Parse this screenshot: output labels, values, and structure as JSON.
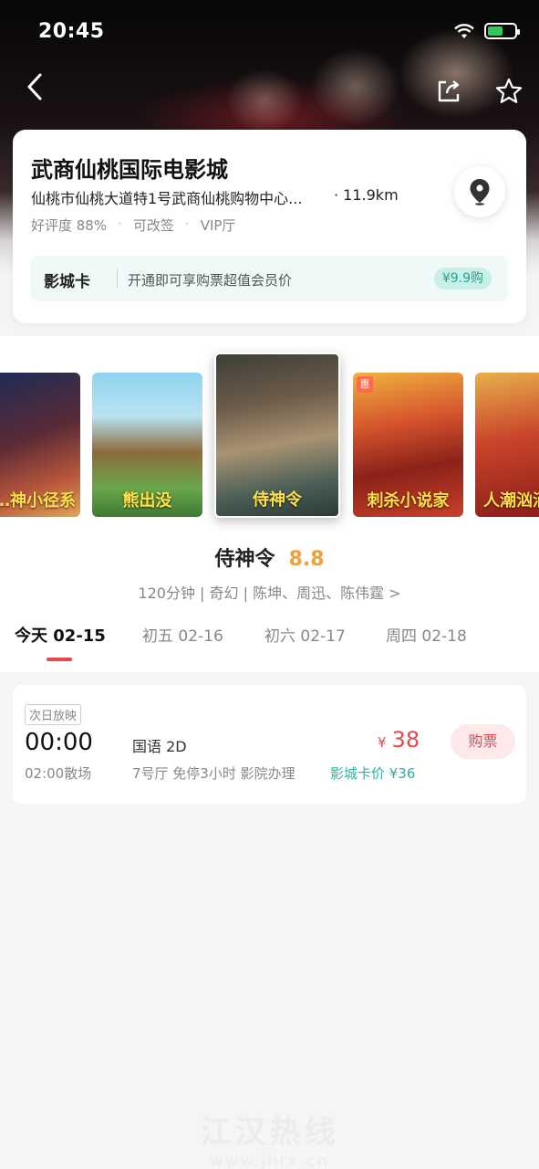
{
  "status_bar": {
    "time": "20:45"
  },
  "cinema": {
    "name": "武商仙桃国际电影城",
    "address": "仙桃市仙桃大道特1号武商仙桃购物中心...",
    "distance": "· 11.9km",
    "tags": [
      "好评度 88%",
      "可改签",
      "VIP厅"
    ],
    "card": {
      "title": "影城卡",
      "desc": "开通即可享购票超值会员价",
      "price": "¥9.9购"
    }
  },
  "posters": [
    {
      "caption": "…神小径系"
    },
    {
      "caption": "熊出没"
    },
    {
      "caption": "侍神令"
    },
    {
      "caption": "刺杀小说家",
      "tag": "惠"
    },
    {
      "caption": "人潮汹涌"
    }
  ],
  "movie": {
    "title": "侍神令",
    "score": "8.8",
    "subtitle": "120分钟 | 奇幻 | 陈坤、周迅、陈伟霆 >"
  },
  "date_tabs": [
    "今天 02-15",
    "初五 02-16",
    "初六 02-17",
    "周四 02-18"
  ],
  "showtime": {
    "badge": "次日放映",
    "start": "00:00",
    "end": "02:00散场",
    "lang": "国语 2D",
    "hall": "7号厅 免停3小时 影院办理",
    "currency": "¥",
    "price": "38",
    "card_price": "影城卡价 ¥36",
    "buy_label": "购票"
  },
  "watermark": {
    "title": "江汉热线",
    "url": "www.jhrx.cn"
  },
  "colors": {
    "accent_red": "#e5484d",
    "score_orange": "#f0a13a",
    "teal": "#2bb3a1"
  }
}
